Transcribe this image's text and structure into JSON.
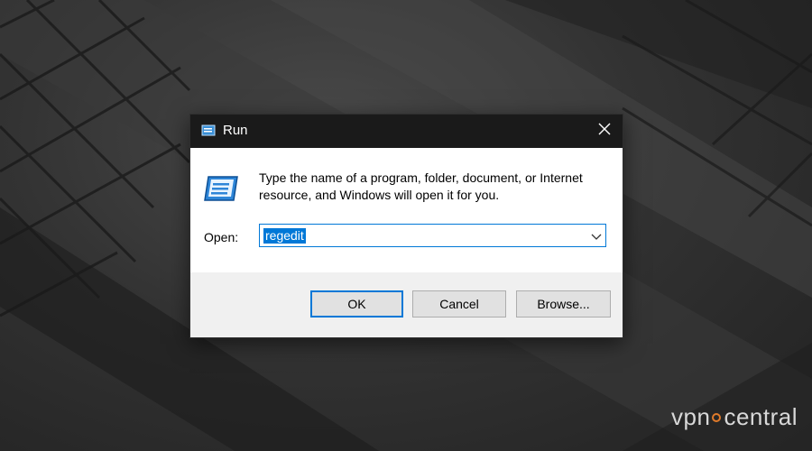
{
  "dialog": {
    "title": "Run",
    "description": "Type the name of a program, folder, document, or Internet resource, and Windows will open it for you.",
    "open_label": "Open:",
    "open_value": "regedit",
    "buttons": {
      "ok": "OK",
      "cancel": "Cancel",
      "browse": "Browse..."
    },
    "icons": {
      "title": "run-icon",
      "main": "run-icon",
      "close": "close-icon",
      "dropdown": "chevron-down-icon"
    }
  },
  "watermark": {
    "left": "vpn",
    "right": "central"
  },
  "colors": {
    "accent": "#0078d7",
    "titlebar": "#1a1a1a",
    "watermark_dot": "#e07a2a"
  }
}
